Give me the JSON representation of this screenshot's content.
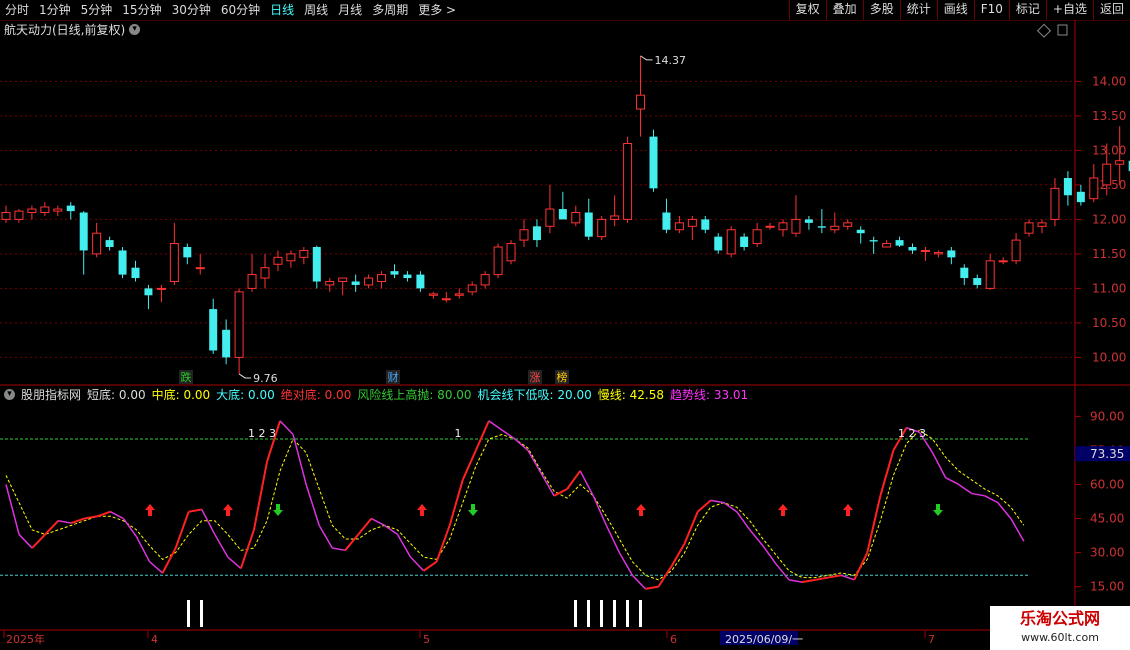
{
  "toolbar": {
    "periods": [
      "分时",
      "1分钟",
      "5分钟",
      "15分钟",
      "30分钟",
      "60分钟",
      "日线",
      "周线",
      "月线",
      "多周期",
      "更多 >"
    ],
    "active_period": "日线",
    "buttons": [
      "复权",
      "叠加",
      "多股",
      "统计",
      "画线",
      "F10",
      "标记",
      "+自选",
      "返回"
    ]
  },
  "stock": {
    "title": "航天动力(日线,前复权)",
    "high_label": "14.37",
    "low_label": "9.76",
    "markers": [
      {
        "text": "跌",
        "color": "#2c2"
      },
      {
        "text": "财",
        "color": "#4af"
      },
      {
        "text": "涨",
        "color": "#f44"
      },
      {
        "text": "榜",
        "color": "#fc0"
      }
    ]
  },
  "price_axis": [
    "14.00",
    "13.50",
    "13.00",
    "12.50",
    "12.00",
    "11.50",
    "11.00",
    "10.50",
    "10.00"
  ],
  "indicator": {
    "name": "股朋指标网",
    "fields": [
      {
        "label": "短底: 0.00",
        "color": "#ddd"
      },
      {
        "label": "中底: 0.00",
        "color": "#ff0"
      },
      {
        "label": "大底: 0.00",
        "color": "#4ff"
      },
      {
        "label": "绝对底: 0.00",
        "color": "#f33"
      },
      {
        "label": "风险线上高抛: 80.00",
        "color": "#3c3"
      },
      {
        "label": "机会线下低吸: 20.00",
        "color": "#4ff"
      },
      {
        "label": "慢线: 42.58",
        "color": "#ff0"
      },
      {
        "label": "趋势线: 33.01",
        "color": "#f3f"
      }
    ],
    "axis": [
      "90.00",
      "75.00",
      "60.00",
      "45.00",
      "30.00",
      "15.00"
    ],
    "current_value": "73.35",
    "seq_labels": [
      "1 2 3",
      "1",
      "1 2 3"
    ]
  },
  "date_axis": {
    "labels": [
      "2025年",
      "4",
      "5",
      "6",
      "2025/06/09/一",
      "7"
    ]
  },
  "watermark": {
    "title": "乐淘公式网",
    "url": "www.60lt.com"
  },
  "chart_data": {
    "type": "candlestick",
    "ylim": [
      9.6,
      14.6
    ],
    "candles": [
      [
        12.0,
        12.2,
        11.95,
        12.1
      ],
      [
        12.0,
        12.15,
        11.95,
        12.12
      ],
      [
        12.1,
        12.2,
        12.0,
        12.15
      ],
      [
        12.1,
        12.25,
        12.05,
        12.18
      ],
      [
        12.12,
        12.2,
        12.05,
        12.15
      ],
      [
        12.2,
        12.25,
        12.0,
        12.12
      ],
      [
        12.1,
        12.12,
        11.2,
        11.55
      ],
      [
        11.5,
        11.95,
        11.45,
        11.8
      ],
      [
        11.7,
        11.75,
        11.55,
        11.6
      ],
      [
        11.55,
        11.6,
        11.15,
        11.2
      ],
      [
        11.3,
        11.4,
        11.1,
        11.15
      ],
      [
        11.0,
        11.05,
        10.7,
        10.9
      ],
      [
        11.0,
        11.05,
        10.8,
        11.0
      ],
      [
        11.1,
        11.95,
        11.05,
        11.65
      ],
      [
        11.6,
        11.65,
        11.35,
        11.45
      ],
      [
        11.3,
        11.5,
        11.2,
        11.3
      ],
      [
        10.7,
        10.85,
        10.05,
        10.1
      ],
      [
        10.4,
        10.55,
        9.9,
        10.0
      ],
      [
        10.0,
        11.0,
        9.76,
        10.95
      ],
      [
        11.0,
        11.5,
        10.95,
        11.2
      ],
      [
        11.15,
        11.5,
        11.0,
        11.3
      ],
      [
        11.35,
        11.55,
        11.25,
        11.45
      ],
      [
        11.4,
        11.55,
        11.3,
        11.5
      ],
      [
        11.45,
        11.6,
        11.35,
        11.55
      ],
      [
        11.6,
        11.62,
        11.0,
        11.1
      ],
      [
        11.05,
        11.15,
        10.95,
        11.1
      ],
      [
        11.1,
        11.15,
        10.9,
        11.15
      ],
      [
        11.1,
        11.2,
        10.95,
        11.05
      ],
      [
        11.05,
        11.2,
        11.0,
        11.15
      ],
      [
        11.1,
        11.25,
        11.0,
        11.2
      ],
      [
        11.25,
        11.35,
        11.15,
        11.2
      ],
      [
        11.2,
        11.25,
        11.1,
        11.15
      ],
      [
        11.2,
        11.25,
        10.95,
        11.0
      ],
      [
        10.9,
        10.95,
        10.85,
        10.92
      ],
      [
        10.85,
        10.95,
        10.8,
        10.85
      ],
      [
        10.9,
        11.0,
        10.85,
        10.92
      ],
      [
        10.95,
        11.1,
        10.9,
        11.05
      ],
      [
        11.05,
        11.25,
        11.0,
        11.2
      ],
      [
        11.2,
        11.65,
        11.15,
        11.6
      ],
      [
        11.4,
        11.7,
        11.35,
        11.65
      ],
      [
        11.7,
        12.0,
        11.6,
        11.85
      ],
      [
        11.9,
        12.0,
        11.6,
        11.7
      ],
      [
        11.9,
        12.5,
        11.8,
        12.15
      ],
      [
        12.15,
        12.4,
        12.0,
        12.0
      ],
      [
        11.95,
        12.2,
        11.9,
        12.1
      ],
      [
        12.1,
        12.3,
        11.7,
        11.75
      ],
      [
        11.75,
        12.05,
        11.7,
        12.0
      ],
      [
        12.0,
        12.35,
        11.9,
        12.05
      ],
      [
        12.0,
        13.2,
        11.95,
        13.1
      ],
      [
        13.6,
        14.37,
        13.2,
        13.8
      ],
      [
        13.2,
        13.3,
        12.4,
        12.45
      ],
      [
        12.1,
        12.3,
        11.8,
        11.85
      ],
      [
        11.85,
        12.05,
        11.8,
        11.95
      ],
      [
        11.9,
        12.05,
        11.7,
        12.0
      ],
      [
        12.0,
        12.05,
        11.8,
        11.85
      ],
      [
        11.75,
        11.8,
        11.5,
        11.55
      ],
      [
        11.5,
        11.9,
        11.45,
        11.85
      ],
      [
        11.75,
        11.8,
        11.55,
        11.6
      ],
      [
        11.65,
        11.95,
        11.6,
        11.85
      ],
      [
        11.9,
        11.95,
        11.85,
        11.9
      ],
      [
        11.85,
        12.0,
        11.75,
        11.95
      ],
      [
        11.8,
        12.35,
        11.75,
        12.0
      ],
      [
        12.0,
        12.05,
        11.85,
        11.95
      ],
      [
        11.9,
        12.15,
        11.8,
        11.88
      ],
      [
        11.85,
        12.1,
        11.8,
        11.9
      ],
      [
        11.9,
        12.0,
        11.85,
        11.95
      ],
      [
        11.85,
        11.9,
        11.65,
        11.8
      ],
      [
        11.7,
        11.75,
        11.5,
        11.68
      ],
      [
        11.6,
        11.7,
        11.6,
        11.65
      ],
      [
        11.7,
        11.75,
        11.6,
        11.62
      ],
      [
        11.6,
        11.65,
        11.5,
        11.55
      ],
      [
        11.55,
        11.6,
        11.4,
        11.55
      ],
      [
        11.5,
        11.55,
        11.45,
        11.52
      ],
      [
        11.55,
        11.6,
        11.35,
        11.45
      ],
      [
        11.3,
        11.35,
        11.05,
        11.15
      ],
      [
        11.15,
        11.2,
        11.0,
        11.05
      ],
      [
        11.0,
        11.5,
        10.98,
        11.4
      ],
      [
        11.4,
        11.45,
        11.35,
        11.4
      ],
      [
        11.4,
        11.8,
        11.35,
        11.7
      ],
      [
        11.8,
        12.0,
        11.75,
        11.95
      ],
      [
        11.9,
        12.0,
        11.8,
        11.95
      ],
      [
        12.0,
        12.6,
        11.9,
        12.45
      ],
      [
        12.6,
        12.7,
        12.2,
        12.35
      ],
      [
        12.4,
        12.5,
        12.2,
        12.25
      ],
      [
        12.3,
        12.8,
        12.25,
        12.6
      ],
      [
        12.5,
        13.1,
        12.35,
        12.8
      ],
      [
        12.8,
        13.35,
        12.5,
        12.85
      ],
      [
        12.85,
        12.95,
        12.55,
        12.7
      ],
      [
        12.65,
        13.0,
        12.55,
        12.85
      ],
      [
        12.8,
        12.9,
        12.6,
        12.6
      ],
      [
        12.45,
        12.55,
        12.3,
        12.55
      ]
    ],
    "indicator_lines": {
      "fast": [
        60,
        38,
        32,
        38,
        44,
        43,
        45,
        46,
        48,
        45,
        37,
        26,
        21,
        32,
        48,
        49,
        38,
        28,
        23,
        40,
        70,
        88,
        82,
        60,
        42,
        32,
        31,
        38,
        45,
        42,
        38,
        28,
        22,
        26,
        42,
        62,
        75,
        88,
        84,
        80,
        75,
        65,
        55,
        58,
        66,
        55,
        42,
        30,
        20,
        14,
        15,
        24,
        34,
        48,
        53,
        52,
        48,
        40,
        33,
        25,
        18,
        17,
        18,
        19,
        20,
        18,
        30,
        55,
        75,
        85,
        83,
        74,
        63,
        60,
        56,
        55,
        52,
        45,
        35
      ],
      "slow": [
        64,
        52,
        40,
        38,
        40,
        42,
        44,
        46,
        46,
        44,
        40,
        33,
        27,
        30,
        38,
        44,
        44,
        38,
        31,
        32,
        44,
        66,
        80,
        74,
        58,
        42,
        36,
        36,
        40,
        42,
        40,
        34,
        28,
        27,
        36,
        52,
        68,
        80,
        82,
        80,
        76,
        66,
        57,
        54,
        60,
        55,
        46,
        36,
        26,
        20,
        18,
        22,
        30,
        42,
        50,
        52,
        50,
        44,
        36,
        29,
        22,
        19,
        19,
        20,
        21,
        20,
        27,
        44,
        64,
        78,
        84,
        80,
        72,
        66,
        62,
        58,
        55,
        50,
        42
      ]
    }
  }
}
